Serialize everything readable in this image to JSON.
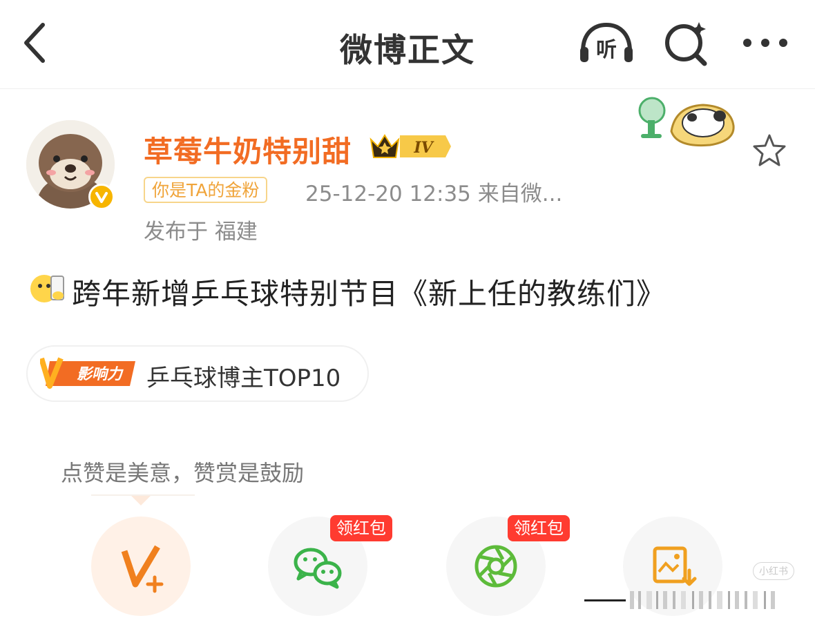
{
  "header": {
    "title": "微博正文",
    "listen_label": "听",
    "icons": [
      "back-icon",
      "listen-icon",
      "search-icon",
      "more-icon"
    ]
  },
  "author": {
    "name": "草莓牛奶特别甜",
    "level": "IV",
    "fan_badge": "你是TA的金粉",
    "meta": "25-12-20 12:35  来自微...",
    "location": "发布于 福建"
  },
  "post": {
    "text": "跨年新增乒乓球特别节目《新上任的教练们》"
  },
  "influence": {
    "logo_text": "影响力",
    "label": "乒乓球博主TOP10"
  },
  "reward": {
    "hint": "点赞是美意，赞赏是鼓励"
  },
  "share": {
    "tag_label": "领红包",
    "buttons": [
      "reward",
      "wechat",
      "moments",
      "save-image"
    ]
  },
  "colors": {
    "accent_orange": "#f26c23",
    "tag_red": "#ff3b30",
    "wechat_green": "#3bb34a",
    "moments_green": "#5dbb3a",
    "gold": "#f7b500"
  }
}
